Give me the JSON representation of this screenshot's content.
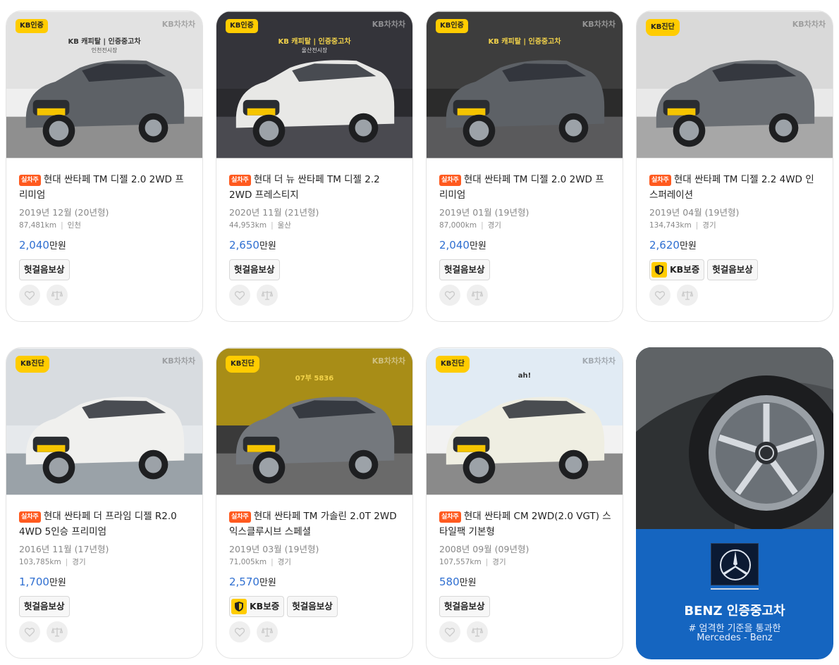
{
  "cards": [
    {
      "badge": "KB인증",
      "tag": "실차주",
      "title": "현대 싼타페 TM 디젤 2.0 2WD 프리미엄",
      "year": "2019년 12월 (20년형)",
      "mileage": "87,481km",
      "region": "인천",
      "price": "2,040",
      "unit": "만원",
      "tags": [
        "헛걸음보상"
      ],
      "kb_warranty": false,
      "photo_text": "KB 캐피탈 | 인증중고차",
      "photo_sub": "인천전시장"
    },
    {
      "badge": "KB인증",
      "tag": "실차주",
      "title": "현대 더 뉴 싼타페 TM 디젤 2.2 2WD 프레스티지",
      "year": "2020년 11월 (21년형)",
      "mileage": "44,953km",
      "region": "울산",
      "price": "2,650",
      "unit": "만원",
      "tags": [
        "헛걸음보상"
      ],
      "kb_warranty": false,
      "photo_text": "KB 캐피탈 | 인증중고차",
      "photo_sub": "울산전시장"
    },
    {
      "badge": "KB인증",
      "tag": "실차주",
      "title": "현대 싼타페 TM 디젤 2.0 2WD 프리미엄",
      "year": "2019년 01월 (19년형)",
      "mileage": "87,000km",
      "region": "경기",
      "price": "2,040",
      "unit": "만원",
      "tags": [
        "헛걸음보상"
      ],
      "kb_warranty": false,
      "photo_text": "KB 캐피탈 | 인증중고차",
      "photo_sub": ""
    },
    {
      "badge": "KB진단",
      "tag": "실차주",
      "title": "현대 싼타페 TM 디젤 2.2 4WD 인스퍼레이션",
      "year": "2019년 04월 (19년형)",
      "mileage": "134,743km",
      "region": "경기",
      "price": "2,620",
      "unit": "만원",
      "tags": [
        "헛걸음보상"
      ],
      "kb_warranty": true,
      "photo_text": "",
      "photo_sub": ""
    },
    {
      "badge": "KB진단",
      "tag": "실차주",
      "title": "현대 싼타페 더 프라임 디젤 R2.0 4WD 5인승 프리미엄",
      "year": "2016년 11월 (17년형)",
      "mileage": "103,785km",
      "region": "경기",
      "price": "1,700",
      "unit": "만원",
      "tags": [
        "헛걸음보상"
      ],
      "kb_warranty": false,
      "photo_text": "",
      "photo_sub": ""
    },
    {
      "badge": "KB진단",
      "tag": "실차주",
      "title": "현대 싼타페 TM 가솔린 2.0T 2WD 익스클루시브 스페셜",
      "year": "2019년 03월 (19년형)",
      "mileage": "71,005km",
      "region": "경기",
      "price": "2,570",
      "unit": "만원",
      "tags": [
        "헛걸음보상"
      ],
      "kb_warranty": true,
      "photo_text": "07부 5836",
      "photo_sub": ""
    },
    {
      "badge": "KB진단",
      "tag": "실차주",
      "title": "현대 싼타페 CM 2WD(2.0 VGT) 스타일팩 기본형",
      "year": "2008년 09월 (09년형)",
      "mileage": "107,557km",
      "region": "경기",
      "price": "580",
      "unit": "만원",
      "tags": [
        "헛걸음보상"
      ],
      "kb_warranty": false,
      "photo_text": "ah!",
      "photo_sub": ""
    }
  ],
  "warranty_label": "KB보증",
  "watermark": "KB차차차",
  "promo": {
    "title": "BENZ 인증중고차",
    "subtitle": "# 엄격한 기준을 통과한",
    "brand": "Mercedes - Benz"
  },
  "colors": {
    "accent": "#2f6fd1",
    "badge": "#ffcc00",
    "own_tag": "#ff5a1f",
    "promo_bg": "#1565c0"
  }
}
